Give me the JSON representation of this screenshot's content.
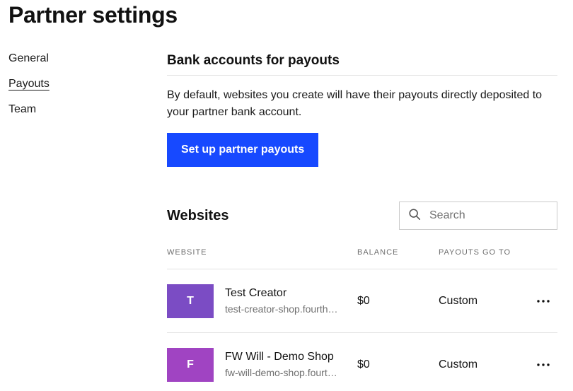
{
  "header": {
    "title": "Partner settings"
  },
  "sidebar": {
    "items": [
      {
        "label": "General",
        "active": false
      },
      {
        "label": "Payouts",
        "active": true
      },
      {
        "label": "Team",
        "active": false
      }
    ]
  },
  "bank_section": {
    "title": "Bank accounts for payouts",
    "description": "By default, websites you create will have their payouts directly deposited to your partner bank account.",
    "button_label": "Set up partner payouts",
    "button_color": "#1749ff"
  },
  "websites": {
    "title": "Websites",
    "search": {
      "placeholder": "Search",
      "value": "",
      "icon": "search-icon"
    },
    "columns": {
      "website": "Website",
      "balance": "Balance",
      "payouts_go_to": "Payouts go to"
    },
    "rows": [
      {
        "initial": "T",
        "color": "#7b4cc4",
        "name": "Test Creator",
        "url": "test-creator-shop.fourthwall.com",
        "balance": "$0",
        "payouts_go_to": "Custom",
        "menu_icon": "more-horizontal-icon"
      },
      {
        "initial": "F",
        "color": "#a044c2",
        "name": "FW Will - Demo Shop",
        "url": "fw-will-demo-shop.fourthwall.com",
        "balance": "$0",
        "payouts_go_to": "Custom",
        "menu_icon": "more-horizontal-icon"
      }
    ]
  }
}
